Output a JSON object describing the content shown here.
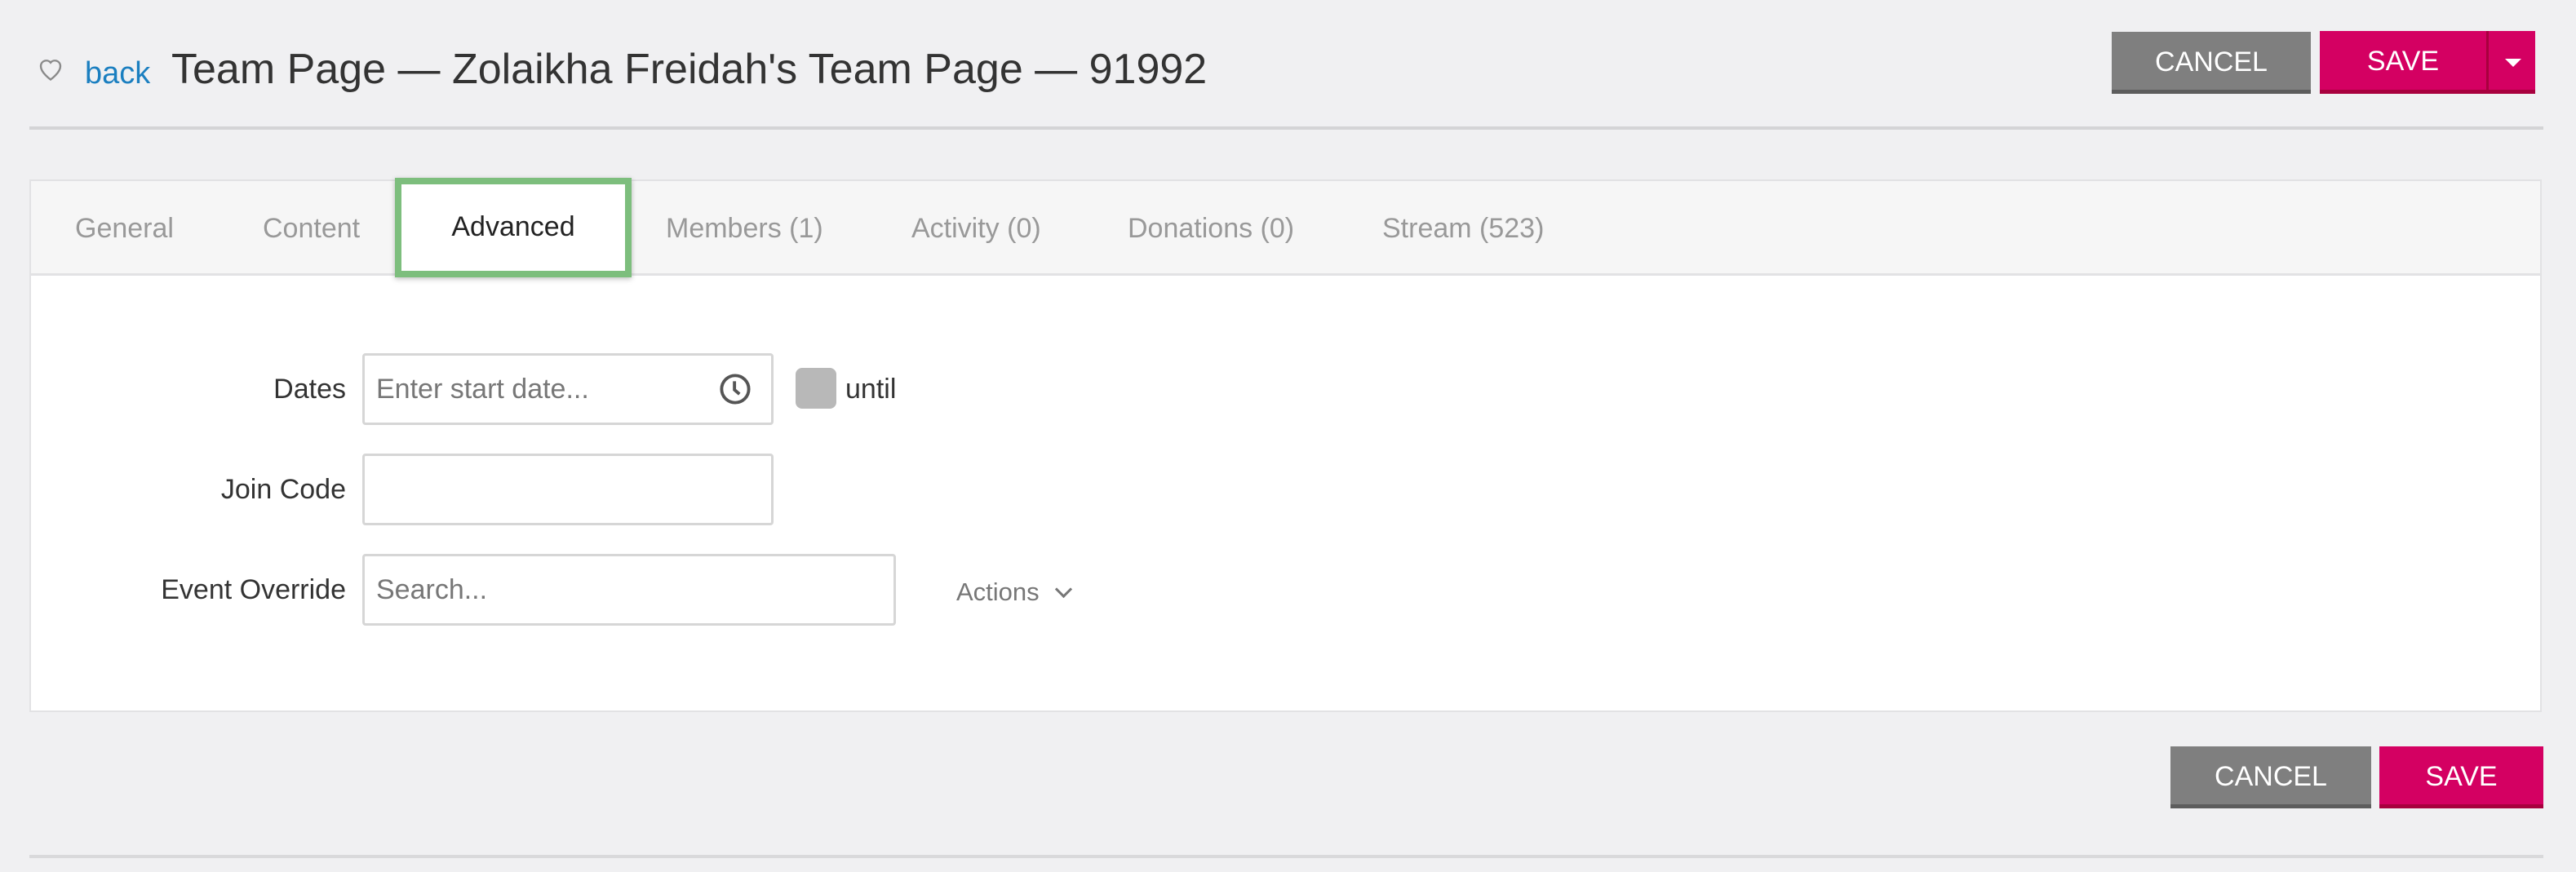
{
  "header": {
    "favorite_icon": "heart-outline-icon",
    "back_label": "back",
    "title": "Team Page — Zolaikha Freidah's Team Page — 91992",
    "cancel_label": "CANCEL",
    "save_label": "SAVE",
    "save_menu_icon": "caret-down-icon"
  },
  "tabs": [
    {
      "label": "General",
      "active": false
    },
    {
      "label": "Content",
      "active": false
    },
    {
      "label": "Advanced",
      "active": true
    },
    {
      "label": "Members (1)",
      "active": false
    },
    {
      "label": "Activity (0)",
      "active": false
    },
    {
      "label": "Donations (0)",
      "active": false
    },
    {
      "label": "Stream (523)",
      "active": false
    }
  ],
  "form": {
    "dates": {
      "label": "Dates",
      "placeholder": "Enter start date...",
      "value": "",
      "icon": "clock-icon",
      "until_checked": false,
      "until_label": "until"
    },
    "join_code": {
      "label": "Join Code",
      "value": ""
    },
    "event_override": {
      "label": "Event Override",
      "placeholder": "Search...",
      "value": ""
    },
    "actions_label": "Actions"
  },
  "footer": {
    "cancel_label": "CANCEL",
    "save_label": "SAVE"
  },
  "colors": {
    "save": "#d40062",
    "cancel": "#7f7f7f",
    "link": "#1b7fc0",
    "active_tab_outline": "#7dbe7d"
  }
}
